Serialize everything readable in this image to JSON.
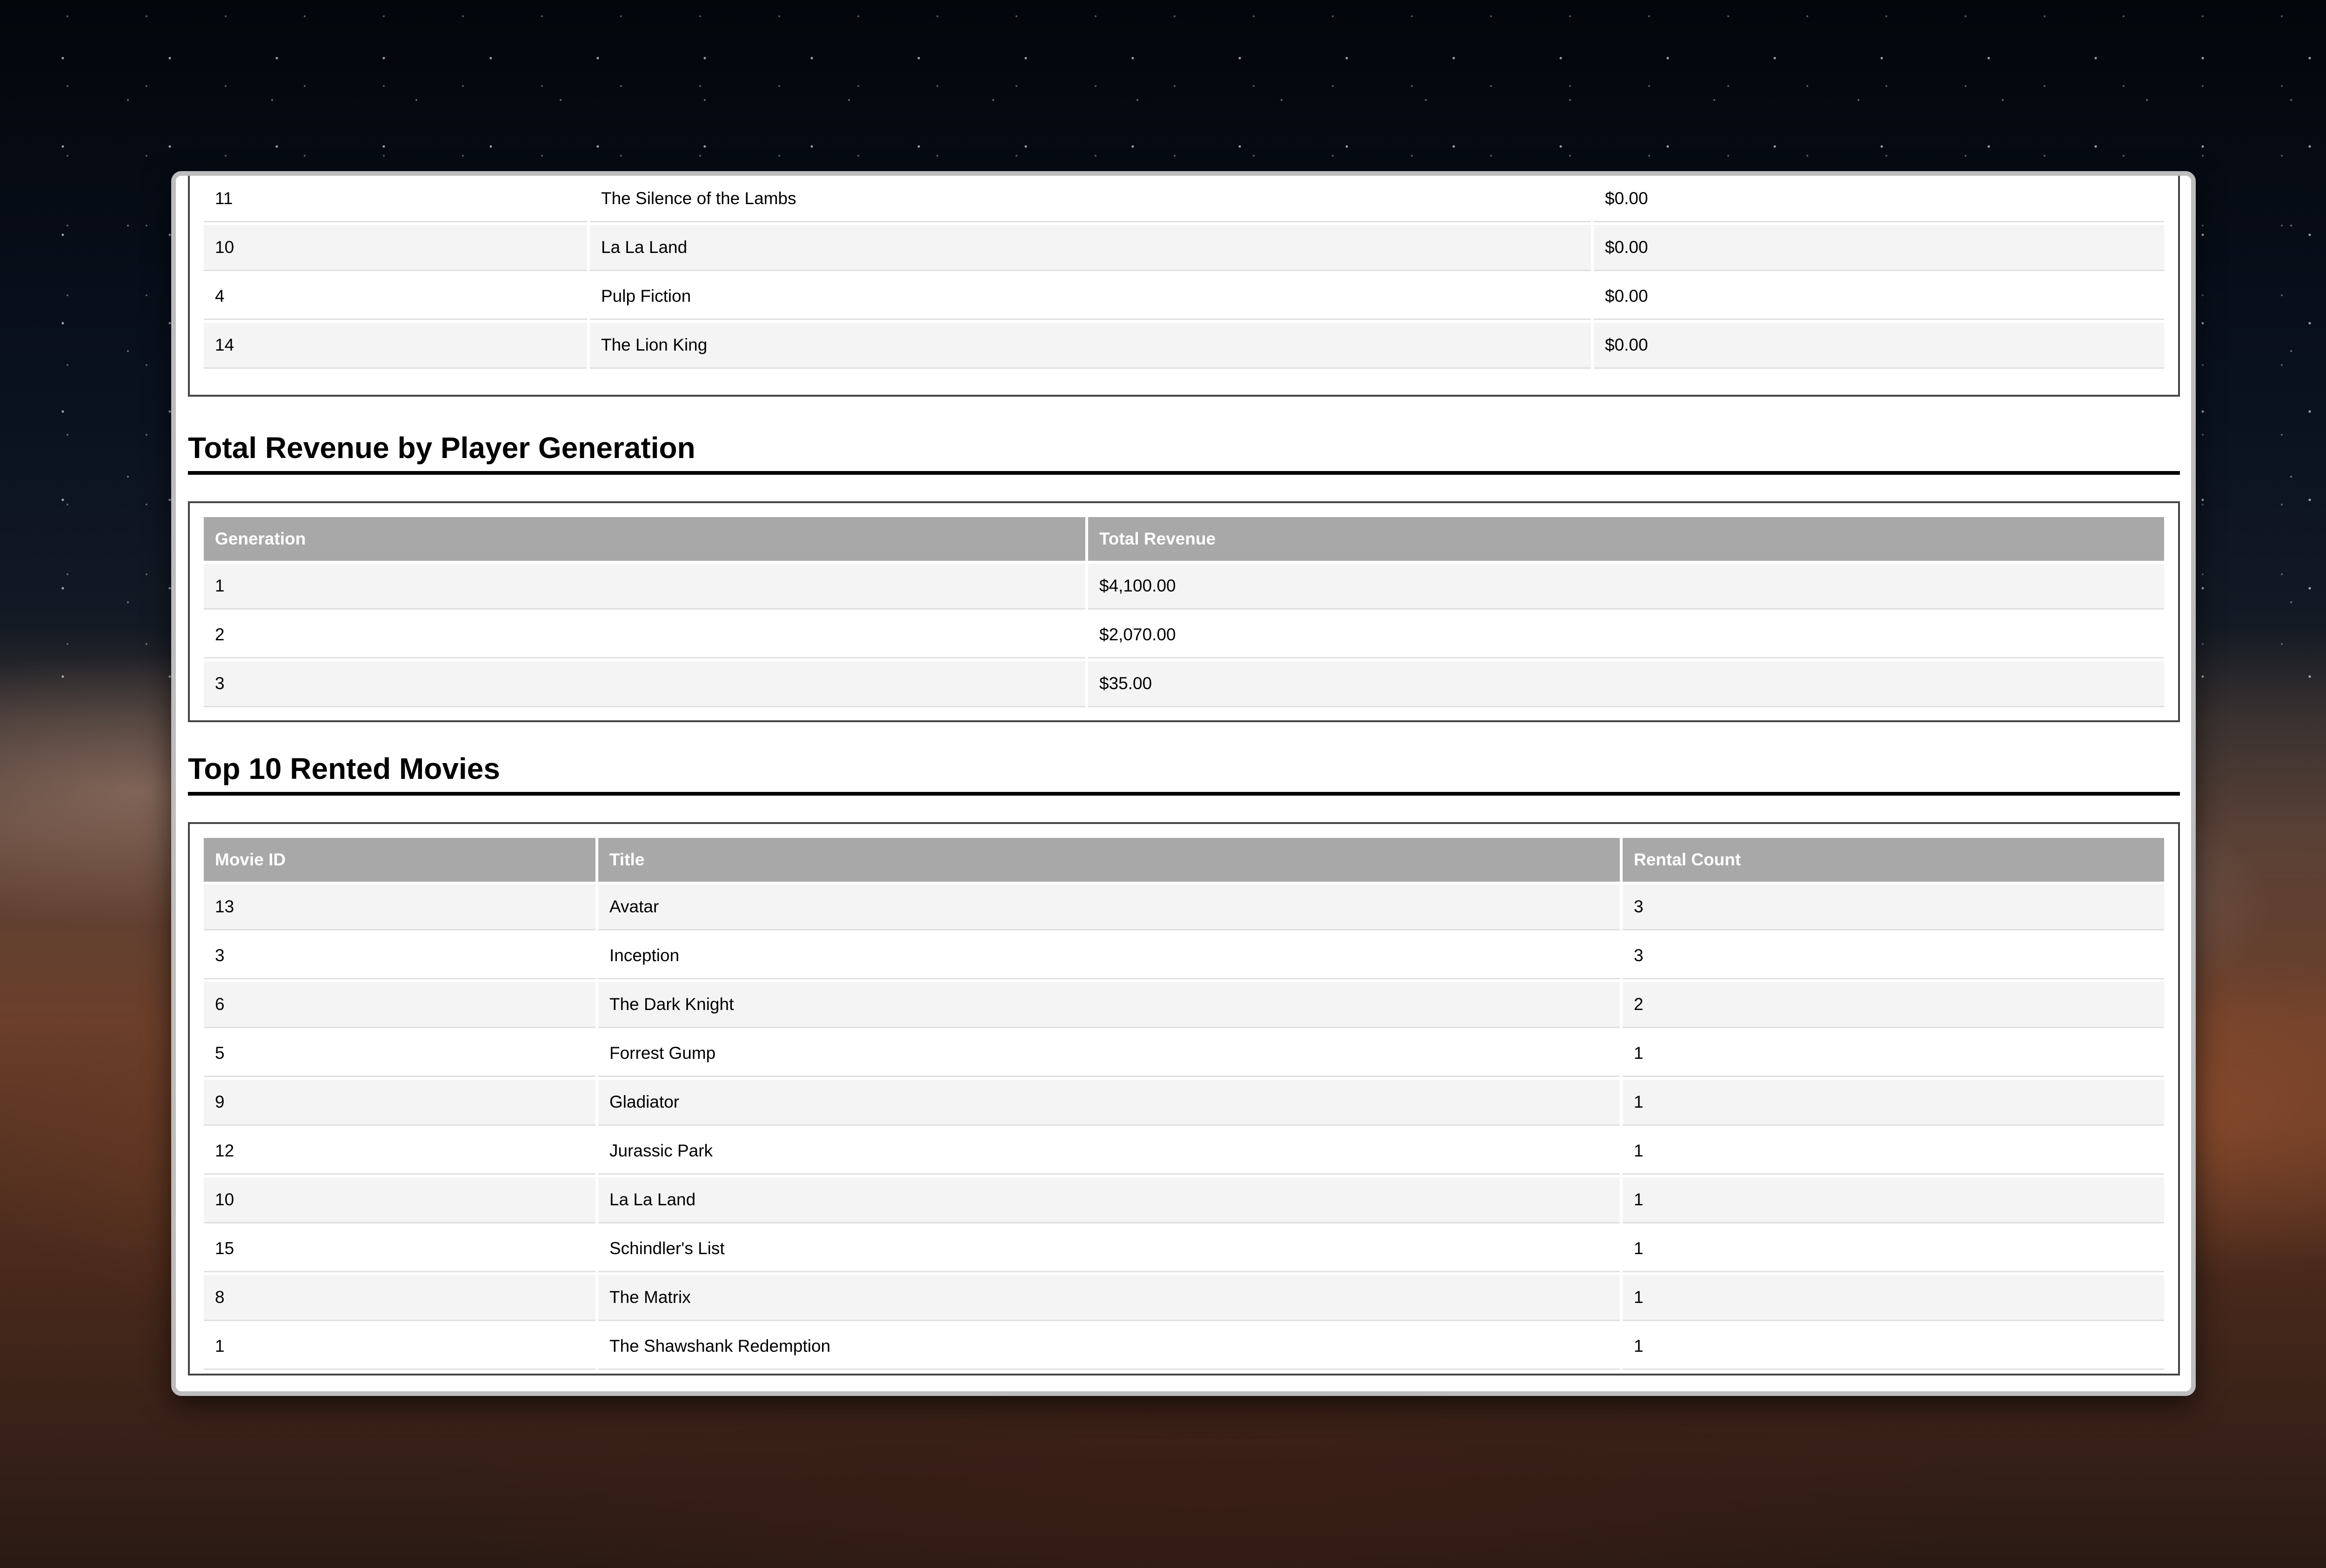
{
  "revenue_by_movie": {
    "rows": [
      {
        "id": "11",
        "title": "The Silence of the Lambs",
        "revenue": "$0.00"
      },
      {
        "id": "10",
        "title": "La La Land",
        "revenue": "$0.00"
      },
      {
        "id": "4",
        "title": "Pulp Fiction",
        "revenue": "$0.00"
      },
      {
        "id": "14",
        "title": "The Lion King",
        "revenue": "$0.00"
      }
    ]
  },
  "revenue_by_generation": {
    "title": "Total Revenue by Player Generation",
    "headers": [
      "Generation",
      "Total Revenue"
    ],
    "rows": [
      {
        "generation": "1",
        "total_revenue": "$4,100.00"
      },
      {
        "generation": "2",
        "total_revenue": "$2,070.00"
      },
      {
        "generation": "3",
        "total_revenue": "$35.00"
      }
    ]
  },
  "top_rented": {
    "title": "Top 10 Rented Movies",
    "headers": [
      "Movie ID",
      "Title",
      "Rental Count"
    ],
    "rows": [
      {
        "id": "13",
        "title": "Avatar",
        "count": "3"
      },
      {
        "id": "3",
        "title": "Inception",
        "count": "3"
      },
      {
        "id": "6",
        "title": "The Dark Knight",
        "count": "2"
      },
      {
        "id": "5",
        "title": "Forrest Gump",
        "count": "1"
      },
      {
        "id": "9",
        "title": "Gladiator",
        "count": "1"
      },
      {
        "id": "12",
        "title": "Jurassic Park",
        "count": "1"
      },
      {
        "id": "10",
        "title": "La La Land",
        "count": "1"
      },
      {
        "id": "15",
        "title": "Schindler's List",
        "count": "1"
      },
      {
        "id": "8",
        "title": "The Matrix",
        "count": "1"
      },
      {
        "id": "1",
        "title": "The Shawshank Redemption",
        "count": "1"
      }
    ]
  }
}
